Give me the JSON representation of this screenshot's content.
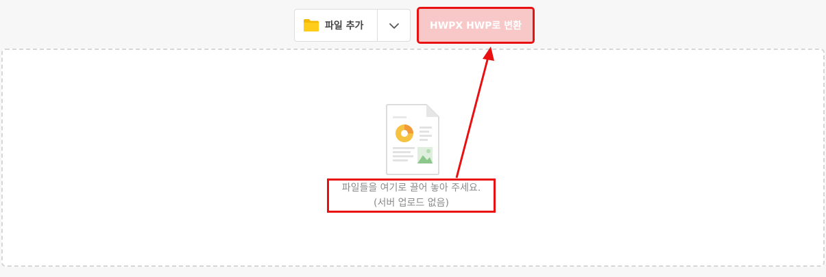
{
  "toolbar": {
    "add_file_label": "파일 추가",
    "convert_label": "HWPX HWP로 변환"
  },
  "drop_zone": {
    "line1": "파일들을 여기로 끌어 놓아 주세요.",
    "line2": "(서버 업로드 없음)"
  },
  "colors": {
    "convert_bg": "#f8c8c8",
    "highlight": "#e81010",
    "folder": "#f5b800"
  }
}
